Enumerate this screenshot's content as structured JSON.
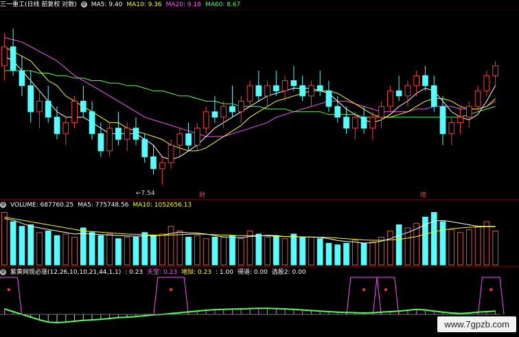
{
  "main_header": {
    "title": "三一重工(日线 前复权 对数)",
    "ma5": "MA5: 9.40",
    "ma10": "MA10: 9.36",
    "ma20": "MA20: 9.18",
    "ma60": "MA60: 8.67"
  },
  "price_annotations": {
    "low_label": "←7.54",
    "marker_1": "财",
    "marker_2": "增"
  },
  "volume_header": {
    "volume": "VOLUME: 687760.25",
    "ma5": "MA5: 775748.56",
    "ma10": "MA10: 1052656.13"
  },
  "indicator_header": {
    "name": "紫黄网现必涨(12,26,10,10,21,44,1,1)",
    "val1": ": 0.23",
    "tiantang": "天堂: 0.23",
    "diyu": "地狱: 0.23",
    "val4": ": 1.00",
    "dedao": "得道: 0.00",
    "xuangu": "选股2: 0.00"
  },
  "watermark": "www.7gpzb.com",
  "colors": {
    "up": "#ff3c3c",
    "down": "#54ffff",
    "ma5": "#ffffff",
    "ma10": "#ffff00",
    "ma20": "#ff55ff",
    "ma60": "#55ff55",
    "vol_up": "#d65a4a",
    "vol_down": "#54ffff",
    "grid": "#a00000"
  },
  "chart_data": {
    "type": "candlestick",
    "price_low_marked": 7.54,
    "candles": [
      {
        "o": 9.7,
        "h": 10.4,
        "l": 9.4,
        "c": 10.1
      },
      {
        "o": 10.1,
        "h": 10.5,
        "l": 9.5,
        "c": 9.6
      },
      {
        "o": 9.6,
        "h": 9.9,
        "l": 9.1,
        "c": 9.3
      },
      {
        "o": 9.3,
        "h": 9.6,
        "l": 8.6,
        "c": 8.8
      },
      {
        "o": 8.8,
        "h": 9.2,
        "l": 8.5,
        "c": 9.0
      },
      {
        "o": 9.0,
        "h": 9.3,
        "l": 8.6,
        "c": 8.7
      },
      {
        "o": 8.7,
        "h": 8.9,
        "l": 8.3,
        "c": 8.4
      },
      {
        "o": 8.4,
        "h": 8.7,
        "l": 8.2,
        "c": 8.6
      },
      {
        "o": 8.6,
        "h": 9.1,
        "l": 8.5,
        "c": 9.0
      },
      {
        "o": 9.0,
        "h": 9.3,
        "l": 8.7,
        "c": 8.8
      },
      {
        "o": 8.8,
        "h": 9.0,
        "l": 8.3,
        "c": 8.4
      },
      {
        "o": 8.4,
        "h": 8.6,
        "l": 8.0,
        "c": 8.1
      },
      {
        "o": 8.1,
        "h": 8.6,
        "l": 8.0,
        "c": 8.5
      },
      {
        "o": 8.5,
        "h": 8.8,
        "l": 8.2,
        "c": 8.3
      },
      {
        "o": 8.3,
        "h": 8.6,
        "l": 8.1,
        "c": 8.5
      },
      {
        "o": 8.5,
        "h": 8.7,
        "l": 8.2,
        "c": 8.3
      },
      {
        "o": 8.3,
        "h": 8.4,
        "l": 7.9,
        "c": 8.0
      },
      {
        "o": 8.0,
        "h": 8.2,
        "l": 7.7,
        "c": 7.8
      },
      {
        "o": 7.8,
        "h": 8.0,
        "l": 7.54,
        "c": 7.9
      },
      {
        "o": 7.9,
        "h": 8.3,
        "l": 7.8,
        "c": 8.2
      },
      {
        "o": 8.2,
        "h": 8.5,
        "l": 8.0,
        "c": 8.4
      },
      {
        "o": 8.4,
        "h": 8.6,
        "l": 8.1,
        "c": 8.2
      },
      {
        "o": 8.2,
        "h": 8.6,
        "l": 8.1,
        "c": 8.5
      },
      {
        "o": 8.5,
        "h": 8.9,
        "l": 8.4,
        "c": 8.8
      },
      {
        "o": 8.8,
        "h": 9.1,
        "l": 8.6,
        "c": 8.7
      },
      {
        "o": 8.7,
        "h": 9.0,
        "l": 8.5,
        "c": 8.9
      },
      {
        "o": 8.9,
        "h": 9.3,
        "l": 8.7,
        "c": 8.8
      },
      {
        "o": 8.8,
        "h": 9.1,
        "l": 8.6,
        "c": 9.0
      },
      {
        "o": 9.0,
        "h": 9.4,
        "l": 8.9,
        "c": 9.3
      },
      {
        "o": 9.3,
        "h": 9.6,
        "l": 9.0,
        "c": 9.1
      },
      {
        "o": 9.1,
        "h": 9.4,
        "l": 8.9,
        "c": 9.3
      },
      {
        "o": 9.3,
        "h": 9.6,
        "l": 9.1,
        "c": 9.2
      },
      {
        "o": 9.2,
        "h": 9.5,
        "l": 9.0,
        "c": 9.4
      },
      {
        "o": 9.4,
        "h": 9.7,
        "l": 9.2,
        "c": 9.3
      },
      {
        "o": 9.3,
        "h": 9.5,
        "l": 9.0,
        "c": 9.1
      },
      {
        "o": 9.1,
        "h": 9.4,
        "l": 8.9,
        "c": 9.3
      },
      {
        "o": 9.3,
        "h": 9.6,
        "l": 9.1,
        "c": 9.2
      },
      {
        "o": 9.2,
        "h": 9.4,
        "l": 8.8,
        "c": 8.9
      },
      {
        "o": 8.9,
        "h": 9.1,
        "l": 8.6,
        "c": 8.7
      },
      {
        "o": 8.7,
        "h": 8.9,
        "l": 8.4,
        "c": 8.5
      },
      {
        "o": 8.5,
        "h": 8.8,
        "l": 8.3,
        "c": 8.7
      },
      {
        "o": 8.7,
        "h": 8.9,
        "l": 8.4,
        "c": 8.5
      },
      {
        "o": 8.5,
        "h": 8.8,
        "l": 8.3,
        "c": 8.7
      },
      {
        "o": 8.7,
        "h": 9.0,
        "l": 8.5,
        "c": 8.9
      },
      {
        "o": 8.9,
        "h": 9.3,
        "l": 8.8,
        "c": 9.2
      },
      {
        "o": 9.2,
        "h": 9.5,
        "l": 9.0,
        "c": 9.1
      },
      {
        "o": 9.1,
        "h": 9.4,
        "l": 8.9,
        "c": 9.3
      },
      {
        "o": 9.3,
        "h": 9.6,
        "l": 9.1,
        "c": 9.5
      },
      {
        "o": 9.5,
        "h": 9.7,
        "l": 9.2,
        "c": 9.3
      },
      {
        "o": 9.3,
        "h": 9.5,
        "l": 8.8,
        "c": 8.9
      },
      {
        "o": 8.9,
        "h": 9.1,
        "l": 8.2,
        "c": 8.4
      },
      {
        "o": 8.4,
        "h": 8.7,
        "l": 8.2,
        "c": 8.6
      },
      {
        "o": 8.6,
        "h": 8.9,
        "l": 8.4,
        "c": 8.7
      },
      {
        "o": 8.7,
        "h": 9.0,
        "l": 8.5,
        "c": 8.9
      },
      {
        "o": 8.9,
        "h": 9.3,
        "l": 8.8,
        "c": 9.2
      },
      {
        "o": 9.2,
        "h": 9.6,
        "l": 9.1,
        "c": 9.5
      },
      {
        "o": 9.5,
        "h": 9.8,
        "l": 9.3,
        "c": 9.7
      }
    ],
    "ma5": [
      9.9,
      9.8,
      9.6,
      9.4,
      9.2,
      9.0,
      8.8,
      8.7,
      8.7,
      8.7,
      8.6,
      8.5,
      8.4,
      8.4,
      8.4,
      8.4,
      8.3,
      8.2,
      8.0,
      7.95,
      8.0,
      8.1,
      8.2,
      8.35,
      8.5,
      8.6,
      8.7,
      8.8,
      8.9,
      9.0,
      9.1,
      9.15,
      9.2,
      9.25,
      9.25,
      9.25,
      9.2,
      9.15,
      9.0,
      8.85,
      8.75,
      8.65,
      8.6,
      8.65,
      8.75,
      8.9,
      9.0,
      9.15,
      9.25,
      9.2,
      9.0,
      8.8,
      8.7,
      8.65,
      8.75,
      9.0,
      9.3
    ],
    "ma10": [
      10.1,
      10.0,
      9.9,
      9.8,
      9.6,
      9.4,
      9.3,
      9.1,
      9.0,
      8.9,
      8.8,
      8.7,
      8.6,
      8.6,
      8.5,
      8.45,
      8.4,
      8.35,
      8.3,
      8.2,
      8.15,
      8.1,
      8.1,
      8.15,
      8.25,
      8.35,
      8.45,
      8.55,
      8.7,
      8.8,
      8.9,
      9.0,
      9.05,
      9.1,
      9.15,
      9.2,
      9.2,
      9.2,
      9.15,
      9.05,
      8.95,
      8.85,
      8.75,
      8.7,
      8.7,
      8.75,
      8.8,
      8.9,
      9.0,
      9.05,
      9.05,
      9.0,
      8.9,
      8.85,
      8.85,
      8.9,
      9.05
    ],
    "ma20": [
      10.3,
      10.25,
      10.2,
      10.1,
      10.0,
      9.9,
      9.8,
      9.65,
      9.5,
      9.4,
      9.3,
      9.2,
      9.1,
      9.0,
      8.9,
      8.8,
      8.7,
      8.65,
      8.6,
      8.55,
      8.5,
      8.45,
      8.4,
      8.35,
      8.35,
      8.35,
      8.4,
      8.45,
      8.5,
      8.55,
      8.6,
      8.7,
      8.75,
      8.8,
      8.85,
      8.9,
      8.95,
      9.0,
      9.0,
      9.0,
      8.95,
      8.9,
      8.85,
      8.8,
      8.8,
      8.8,
      8.8,
      8.85,
      8.85,
      8.9,
      8.9,
      8.9,
      8.85,
      8.85,
      8.85,
      8.9,
      9.0
    ],
    "ma60": [
      9.6,
      9.6,
      9.6,
      9.6,
      9.55,
      9.55,
      9.5,
      9.5,
      9.45,
      9.45,
      9.4,
      9.4,
      9.35,
      9.35,
      9.3,
      9.3,
      9.25,
      9.2,
      9.2,
      9.15,
      9.1,
      9.1,
      9.05,
      9.0,
      9.0,
      8.95,
      8.95,
      8.9,
      8.9,
      8.9,
      8.85,
      8.85,
      8.85,
      8.8,
      8.8,
      8.8,
      8.8,
      8.75,
      8.75,
      8.75,
      8.75,
      8.7,
      8.7,
      8.7,
      8.7,
      8.7,
      8.7,
      8.7,
      8.7,
      8.7,
      8.7,
      8.7,
      8.7,
      8.75,
      8.8,
      8.85,
      8.9
    ],
    "volumes": [
      1700000,
      1400000,
      1250000,
      1300000,
      1050000,
      1100000,
      950000,
      1000000,
      900000,
      1200000,
      1050000,
      950000,
      1000000,
      850000,
      900000,
      900000,
      1050000,
      950000,
      1000000,
      1250000,
      1100000,
      900000,
      950000,
      850000,
      900000,
      900000,
      950000,
      850000,
      1100000,
      1000000,
      900000,
      950000,
      850000,
      1000000,
      900000,
      900000,
      850000,
      700000,
      650000,
      700000,
      800000,
      700000,
      750000,
      900000,
      1100000,
      1300000,
      1200000,
      1350000,
      1550000,
      1700000,
      1400000,
      1150000,
      1050000,
      1150000,
      1250000,
      1400000,
      1100000
    ],
    "vol_ma5": [
      1500000,
      1450000,
      1350000,
      1250000,
      1200000,
      1150000,
      1100000,
      1050000,
      1000000,
      1020000,
      1000000,
      980000,
      970000,
      950000,
      940000,
      930000,
      940000,
      950000,
      960000,
      1020000,
      1060000,
      1040000,
      1030000,
      1000000,
      950000,
      910000,
      900000,
      880000,
      920000,
      940000,
      960000,
      950000,
      920000,
      920000,
      910000,
      900000,
      890000,
      850000,
      790000,
      760000,
      740000,
      710000,
      720000,
      770000,
      850000,
      960000,
      1050000,
      1170000,
      1300000,
      1420000,
      1440000,
      1400000,
      1350000,
      1300000,
      1250000,
      1250000,
      1250000
    ],
    "vol_ma10": [
      1550000,
      1500000,
      1450000,
      1400000,
      1350000,
      1300000,
      1250000,
      1200000,
      1150000,
      1100000,
      1080000,
      1060000,
      1040000,
      1020000,
      1000000,
      990000,
      980000,
      970000,
      960000,
      970000,
      980000,
      990000,
      1000000,
      990000,
      980000,
      970000,
      960000,
      950000,
      950000,
      950000,
      940000,
      930000,
      920000,
      910000,
      910000,
      905000,
      900000,
      890000,
      870000,
      850000,
      830000,
      810000,
      800000,
      800000,
      810000,
      830000,
      870000,
      920000,
      990000,
      1070000,
      1130000,
      1170000,
      1200000,
      1220000,
      1230000,
      1240000,
      1240000
    ],
    "indicator_signals": [
      {
        "kind": "pulse",
        "start": 0,
        "end": 1
      },
      {
        "kind": "pulse",
        "start": 18,
        "end": 20
      },
      {
        "kind": "pulse",
        "start": 40,
        "end": 42
      },
      {
        "kind": "pulse",
        "start": 43,
        "end": 44
      },
      {
        "kind": "pulse",
        "start": 55,
        "end": 56
      }
    ],
    "indicator_wave": [
      0.2,
      0.1,
      0.0,
      -0.1,
      -0.2,
      -0.28,
      -0.3,
      -0.28,
      -0.25,
      -0.22,
      -0.2,
      -0.18,
      -0.15,
      -0.12,
      -0.1,
      -0.08,
      -0.05,
      -0.02,
      0.0,
      0.03,
      0.06,
      0.09,
      0.12,
      0.15,
      0.17,
      0.18,
      0.19,
      0.2,
      0.21,
      0.22,
      0.22,
      0.21,
      0.2,
      0.18,
      0.16,
      0.14,
      0.12,
      0.1,
      0.08,
      0.07,
      0.06,
      0.05,
      0.06,
      0.08,
      0.1,
      0.12,
      0.15,
      0.18,
      0.16,
      0.12,
      0.08,
      0.05,
      0.03,
      0.05,
      0.08,
      0.1,
      0.12
    ]
  }
}
